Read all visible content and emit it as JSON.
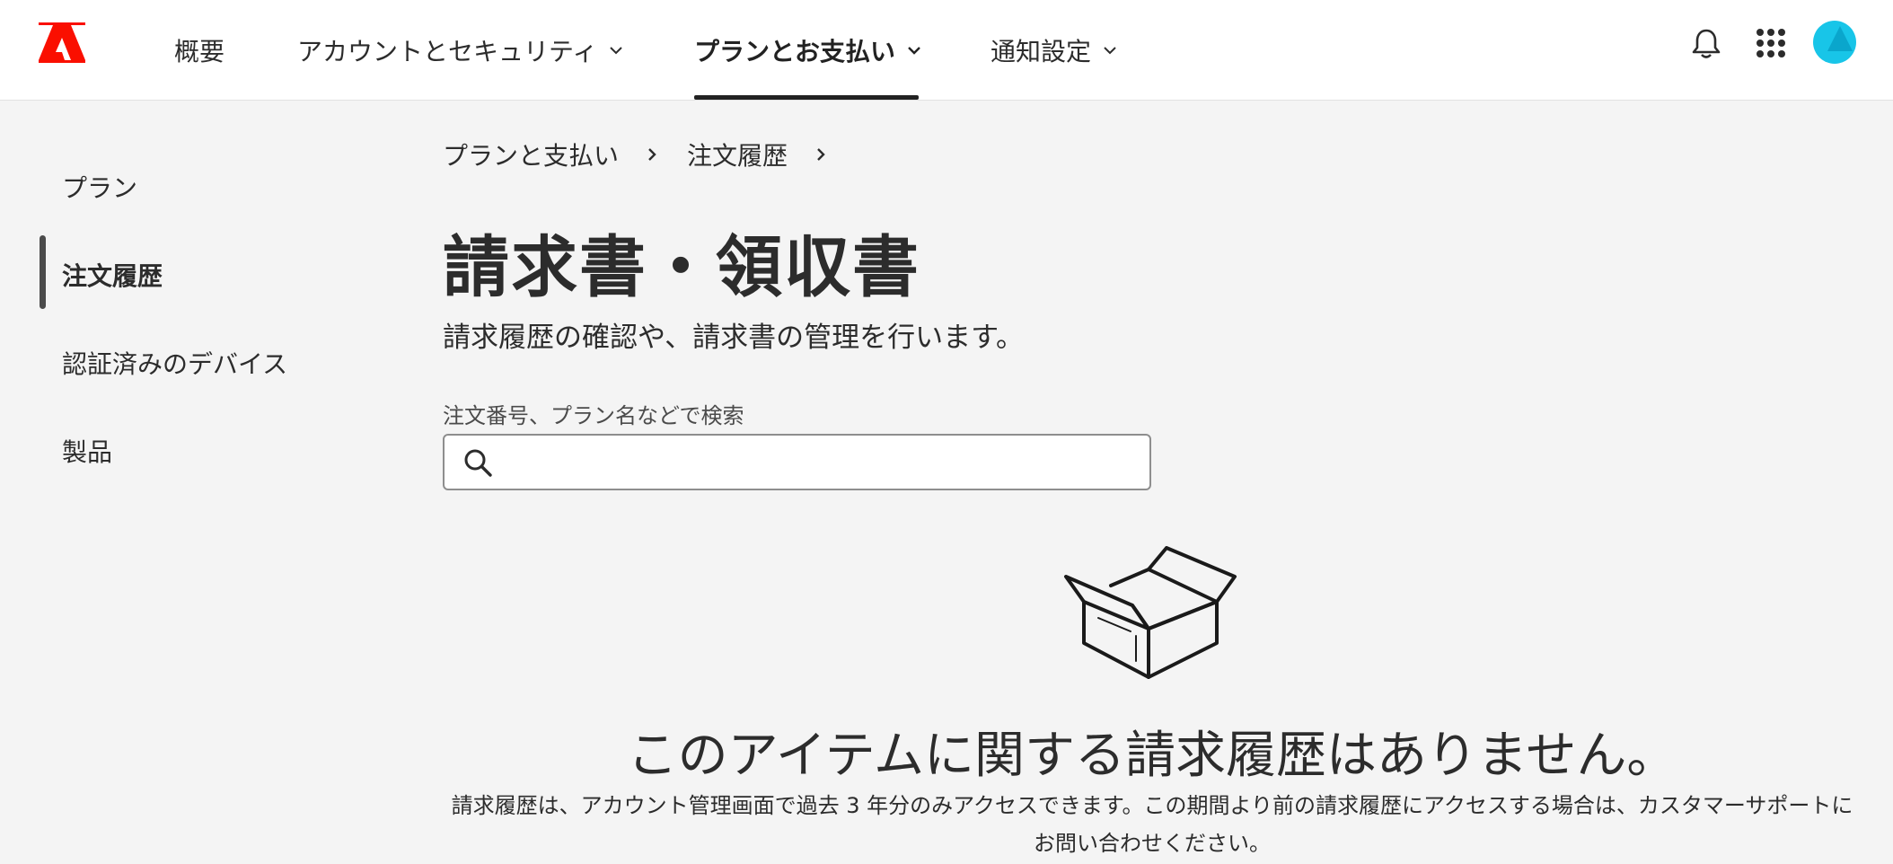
{
  "header": {
    "logo": "adobe-logo",
    "nav": [
      {
        "label": "概要"
      },
      {
        "label": "アカウントとセキュリティ"
      },
      {
        "label": "プランとお支払い"
      },
      {
        "label": "通知設定"
      }
    ],
    "brand_color": "#fa0f00",
    "avatar_color": "#18c5e8"
  },
  "sidebar": {
    "items": [
      {
        "label": "プラン"
      },
      {
        "label": "注文履歴"
      },
      {
        "label": "認証済みのデバイス"
      },
      {
        "label": "製品"
      }
    ],
    "active_index": 1
  },
  "breadcrumb": {
    "items": [
      {
        "label": "プランと支払い"
      },
      {
        "label": "注文履歴"
      }
    ]
  },
  "main": {
    "title": "請求書・領収書",
    "subtitle": "請求履歴の確認や、請求書の管理を行います。",
    "search": {
      "label": "注文番号、プラン名などで検索",
      "value": "",
      "placeholder": ""
    },
    "empty": {
      "title": "このアイテムに関する請求履歴はありません。",
      "description": "請求履歴は、アカウント管理画面で過去 3 年分のみアクセスできます。この期間より前の請求履歴にアクセスする場合は、カスタマーサポートにお問い合わせください。"
    }
  }
}
